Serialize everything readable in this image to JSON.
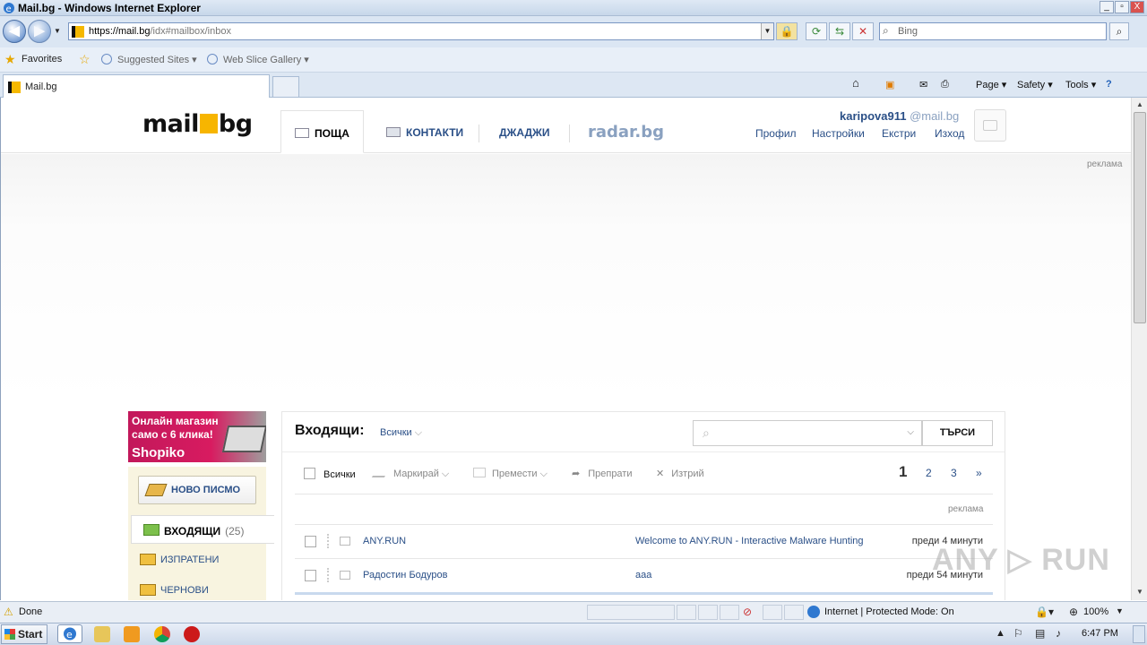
{
  "window": {
    "title": "Mail.bg - Windows Internet Explorer",
    "min": "_",
    "max": "▫",
    "close": "X"
  },
  "browser": {
    "back": "◀",
    "forward": "▶",
    "url_main": "https://mail.bg",
    "url_rest": "/idx#mailbox/inbox",
    "search_placeholder": "Bing",
    "favorites_label": "Favorites",
    "suggested_sites": "Suggested Sites ▾",
    "web_slice_gallery": "Web Slice Gallery ▾",
    "tab_label": "Mail.bg",
    "commands": [
      "Page ▾",
      "Safety ▾",
      "Tools ▾"
    ]
  },
  "site": {
    "logo_left": "mail",
    "logo_right": "bg",
    "nav": [
      {
        "label": "ПОЩА"
      },
      {
        "label": "КОНТАКТИ"
      },
      {
        "label": "ДЖАДЖИ"
      }
    ],
    "radar": "radar.bg",
    "user_name": "karipova911",
    "user_domain": "@mail.bg",
    "user_links": [
      "Профил",
      "Настройки",
      "Екстри",
      "Изход"
    ],
    "ad_label_top": "реклама"
  },
  "banner": {
    "line1": "Онлайн магазин само с 6 клика!",
    "brand": "Shopiko"
  },
  "sidebar": {
    "compose": "НОВО ПИСМО",
    "folders": [
      {
        "label": "ВХОДЯЩИ",
        "count": "(25)"
      },
      {
        "label": "ИЗПРАТЕНИ",
        "count": ""
      },
      {
        "label": "ЧЕРНОВИ",
        "count": ""
      }
    ]
  },
  "mailbox": {
    "title": "Входящи:",
    "filter": "Всички",
    "search_button": "ТЪРСИ",
    "toolbar": {
      "select_all": "Всички",
      "mark": "Маркирай",
      "move": "Премести",
      "forward": "Препрати",
      "delete": "Изтрий"
    },
    "pages": [
      "1",
      "2",
      "3",
      "»"
    ],
    "ad_label": "реклама",
    "messages": [
      {
        "from": "ANY.RUN",
        "subject": "Welcome to ANY.RUN - Interactive Malware Hunting",
        "time": "преди 4 минути"
      },
      {
        "from": "Радостин Бодуров",
        "subject": "aaa",
        "time": "преди 54 минути"
      }
    ]
  },
  "status": {
    "left": "Done",
    "zone": "Internet | Protected Mode: On",
    "zoom": "100%"
  },
  "taskbar": {
    "start": "Start",
    "clock": "6:47 PM"
  },
  "watermark": "ANY ▷ RUN"
}
